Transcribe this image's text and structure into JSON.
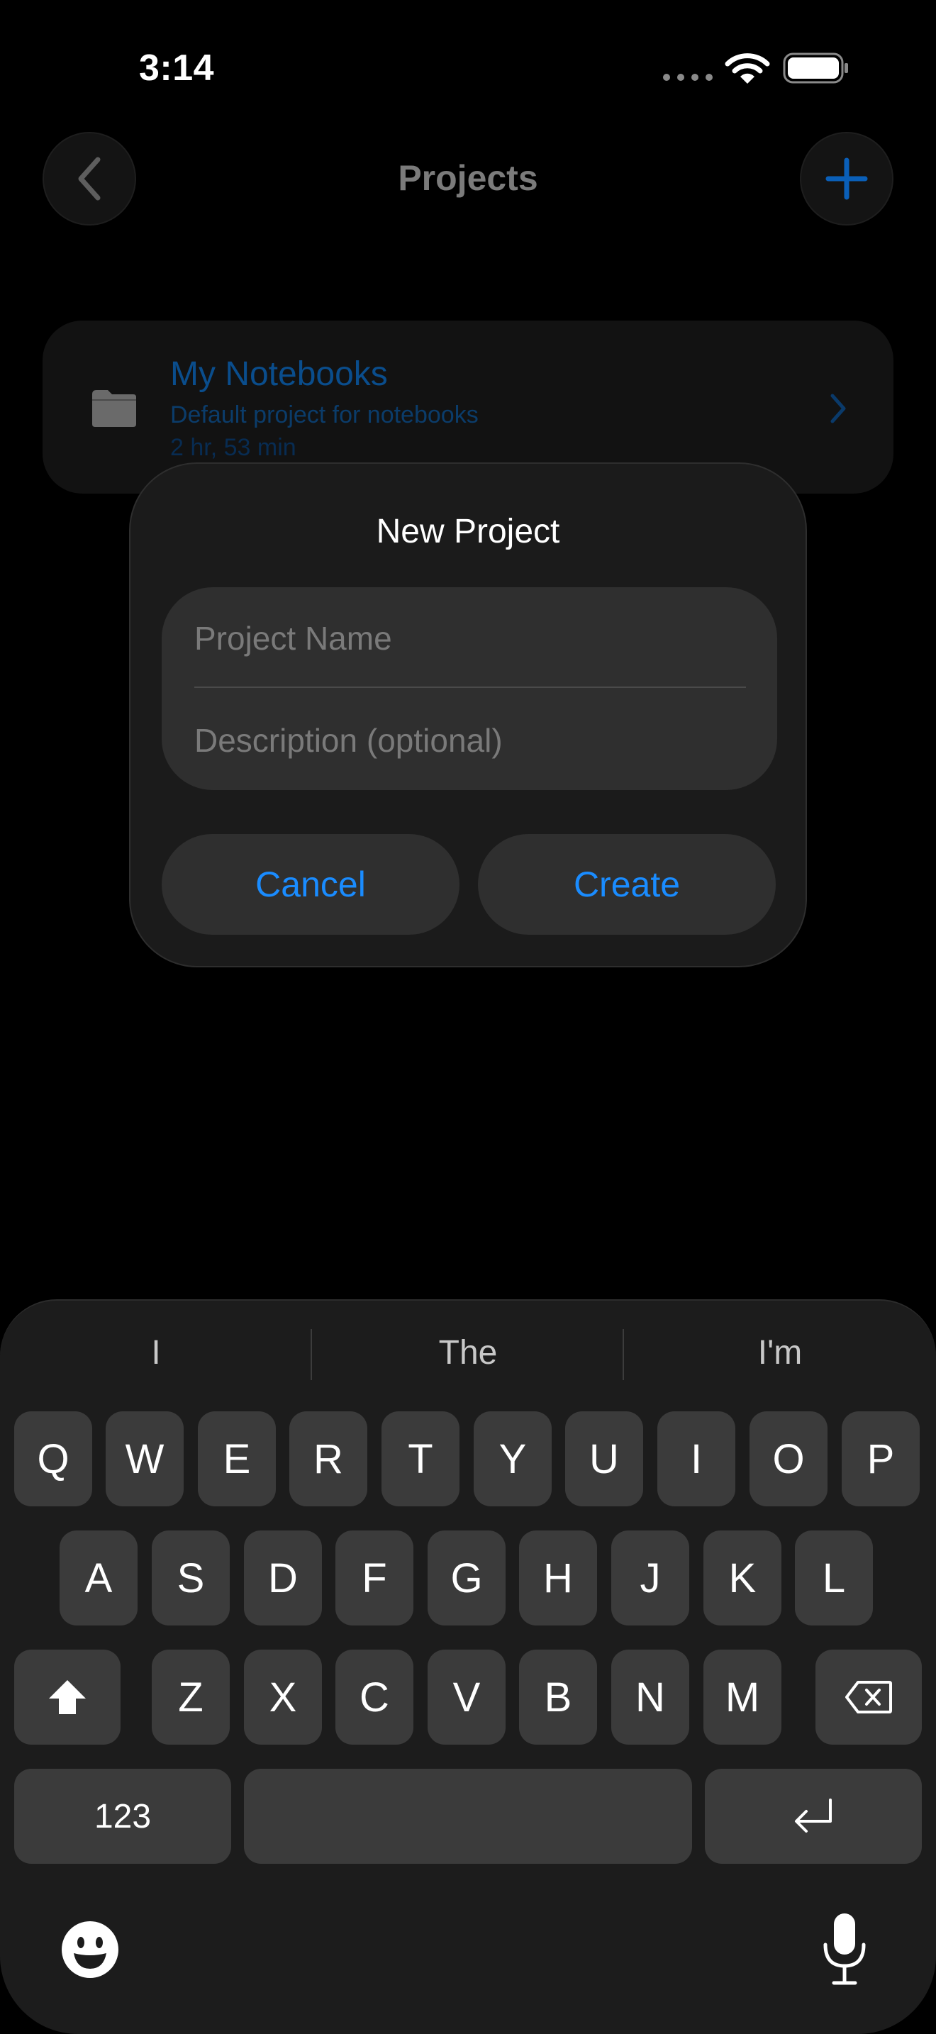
{
  "status": {
    "time": "3:14"
  },
  "nav": {
    "title": "Projects"
  },
  "project": {
    "name": "My Notebooks",
    "description": "Default project for notebooks",
    "duration": "2 hr, 53 min"
  },
  "dialog": {
    "title": "New Project",
    "name_placeholder": "Project Name",
    "description_placeholder": "Description (optional)",
    "cancel_label": "Cancel",
    "create_label": "Create"
  },
  "keyboard": {
    "suggestions": [
      "I",
      "The",
      "I'm"
    ],
    "row1": [
      "Q",
      "W",
      "E",
      "R",
      "T",
      "Y",
      "U",
      "I",
      "O",
      "P"
    ],
    "row2": [
      "A",
      "S",
      "D",
      "F",
      "G",
      "H",
      "J",
      "K",
      "L"
    ],
    "row3": [
      "Z",
      "X",
      "C",
      "V",
      "B",
      "N",
      "M"
    ],
    "numbers_label": "123"
  },
  "colors": {
    "accent": "#1a8cff",
    "background": "#000000",
    "dialog": "#1b1b1b",
    "field": "#2f2f2f",
    "key": "#3b3b3b"
  }
}
